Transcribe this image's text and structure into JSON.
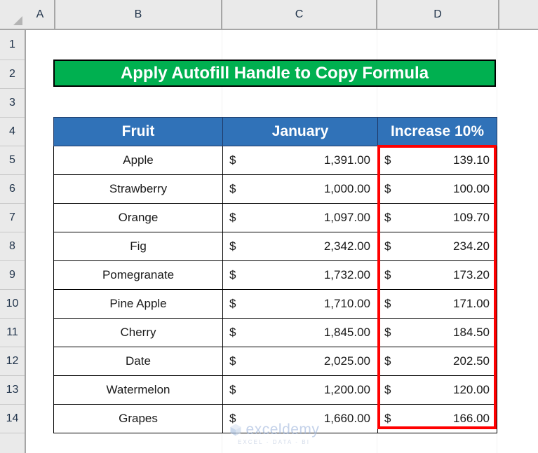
{
  "app": {
    "type": "spreadsheet"
  },
  "grid": {
    "column_headers": [
      "A",
      "B",
      "C",
      "D"
    ],
    "row_headers": [
      "1",
      "2",
      "3",
      "4",
      "5",
      "6",
      "7",
      "8",
      "9",
      "10",
      "11",
      "12",
      "13",
      "14"
    ]
  },
  "banner": {
    "title": "Apply Autofill Handle to Copy Formula",
    "background_color": "#00b050",
    "text_color": "#ffffff"
  },
  "table": {
    "header_background_color": "#3072b8",
    "headers": [
      "Fruit",
      "January",
      "Increase 10%"
    ],
    "rows": [
      {
        "fruit": "Apple",
        "january_currency": "$",
        "january_amount": "1,391.00",
        "increase_currency": "$",
        "increase_amount": "139.10"
      },
      {
        "fruit": "Strawberry",
        "january_currency": "$",
        "january_amount": "1,000.00",
        "increase_currency": "$",
        "increase_amount": "100.00"
      },
      {
        "fruit": "Orange",
        "january_currency": "$",
        "january_amount": "1,097.00",
        "increase_currency": "$",
        "increase_amount": "109.70"
      },
      {
        "fruit": "Fig",
        "january_currency": "$",
        "january_amount": "2,342.00",
        "increase_currency": "$",
        "increase_amount": "234.20"
      },
      {
        "fruit": "Pomegranate",
        "january_currency": "$",
        "january_amount": "1,732.00",
        "increase_currency": "$",
        "increase_amount": "173.20"
      },
      {
        "fruit": "Pine Apple",
        "january_currency": "$",
        "january_amount": "1,710.00",
        "increase_currency": "$",
        "increase_amount": "171.00"
      },
      {
        "fruit": "Cherry",
        "january_currency": "$",
        "january_amount": "1,845.00",
        "increase_currency": "$",
        "increase_amount": "184.50"
      },
      {
        "fruit": "Date",
        "january_currency": "$",
        "january_amount": "2,025.00",
        "increase_currency": "$",
        "increase_amount": "202.50"
      },
      {
        "fruit": "Watermelon",
        "january_currency": "$",
        "january_amount": "1,200.00",
        "increase_currency": "$",
        "increase_amount": "120.00"
      },
      {
        "fruit": "Grapes",
        "january_currency": "$",
        "january_amount": "1,660.00",
        "increase_currency": "$",
        "increase_amount": "166.00"
      }
    ]
  },
  "highlight": {
    "color": "#ff0000",
    "target_column": "Increase 10%"
  },
  "watermark": {
    "text": "exceldemy",
    "tagline": "EXCEL - DATA - BI"
  }
}
